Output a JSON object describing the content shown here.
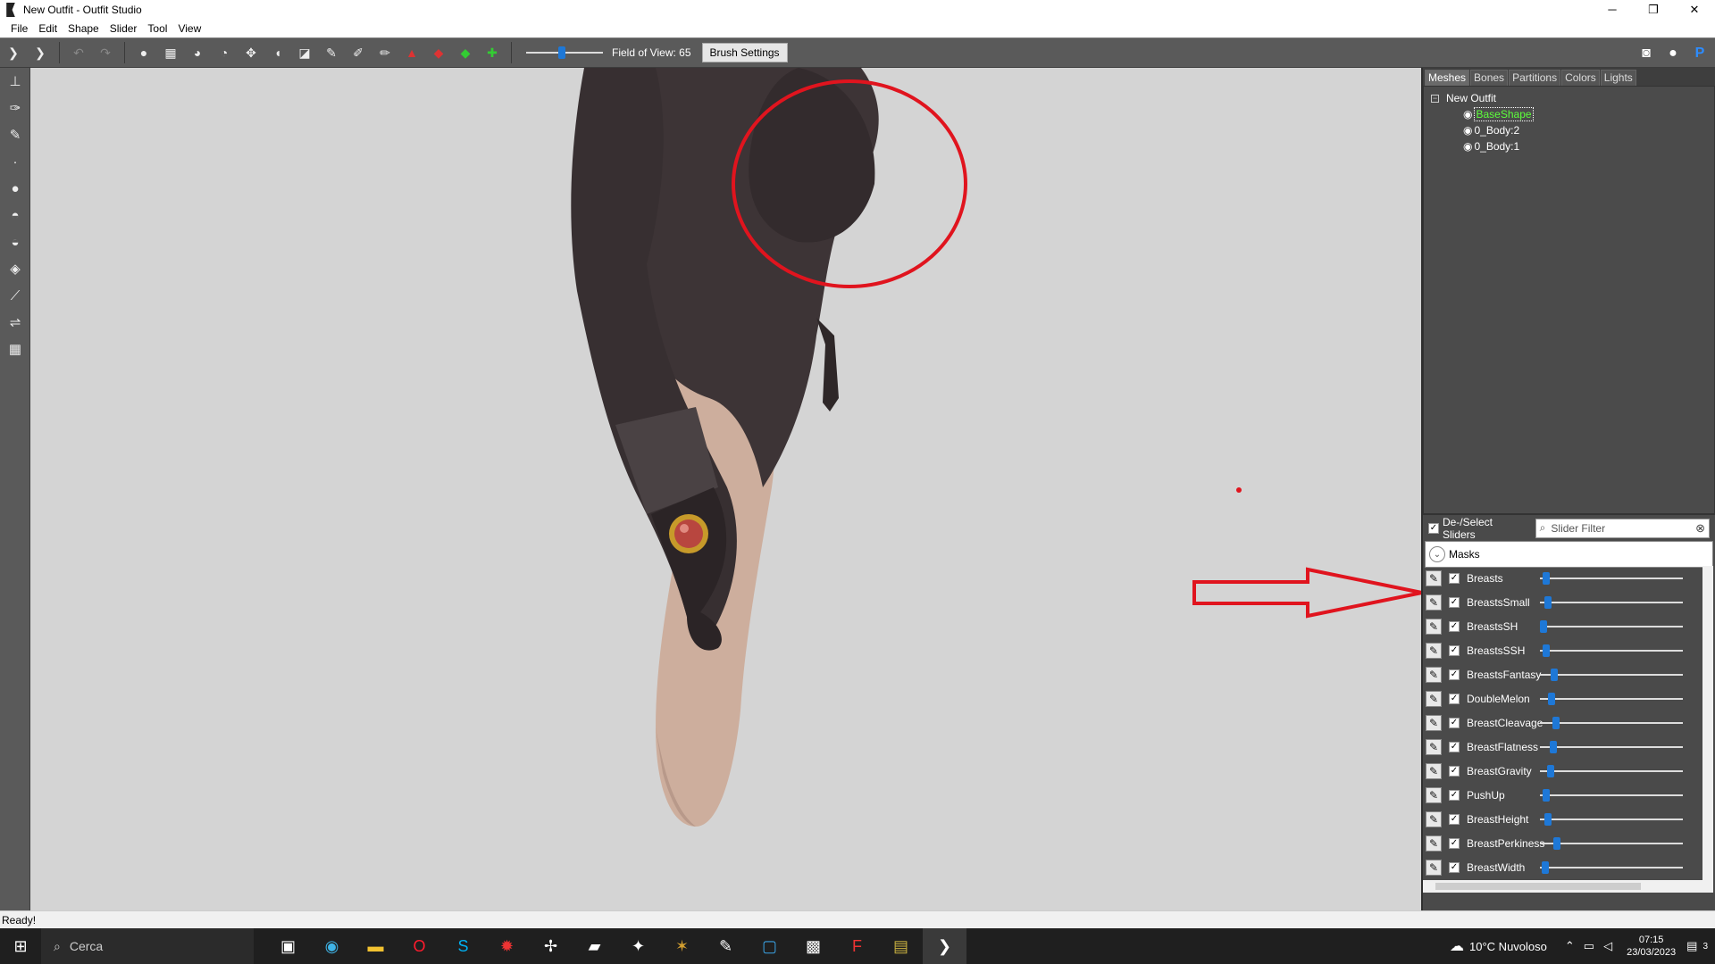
{
  "window": {
    "title": "New Outfit - Outfit Studio",
    "minimize": "─",
    "maximize": "❐",
    "close": "✕"
  },
  "menu": [
    "File",
    "Edit",
    "Shape",
    "Slider",
    "Tool",
    "View"
  ],
  "toolbar": {
    "fov_label": "Field of View: 65",
    "fov_value": 65,
    "brush_settings": "Brush Settings"
  },
  "panel": {
    "tabs": [
      "Meshes",
      "Bones",
      "Partitions",
      "Colors",
      "Lights"
    ],
    "active_tab": "Meshes",
    "tree": {
      "root": "New Outfit",
      "meshes": [
        "BaseShape",
        "0_Body:2",
        "0_Body:1"
      ],
      "selected": "BaseShape"
    },
    "deselect_label": "De-/Select Sliders",
    "filter_placeholder": "Slider Filter",
    "masks_label": "Masks",
    "sliders": [
      {
        "name": "Breasts",
        "value": 0.02
      },
      {
        "name": "BreastsSmall",
        "value": 0.03
      },
      {
        "name": "BreastsSH",
        "value": 0.0
      },
      {
        "name": "BreastsSSH",
        "value": 0.02
      },
      {
        "name": "BreastsFantasy",
        "value": 0.08
      },
      {
        "name": "DoubleMelon",
        "value": 0.06
      },
      {
        "name": "BreastCleavage",
        "value": 0.09
      },
      {
        "name": "BreastFlatness",
        "value": 0.07
      },
      {
        "name": "BreastGravity",
        "value": 0.05
      },
      {
        "name": "PushUp",
        "value": 0.02
      },
      {
        "name": "BreastHeight",
        "value": 0.03
      },
      {
        "name": "BreastPerkiness",
        "value": 0.1
      },
      {
        "name": "BreastWidth",
        "value": 0.01
      }
    ]
  },
  "status": "Ready!",
  "taskbar": {
    "search_label": "Cerca",
    "weather": "10°C  Nuvoloso",
    "time": "07:15",
    "date": "23/03/2023",
    "notifications": "3"
  },
  "colors": {
    "accent": "#1e78d7",
    "selected_mesh": "#5cff3a",
    "annotation": "#e0141e"
  }
}
